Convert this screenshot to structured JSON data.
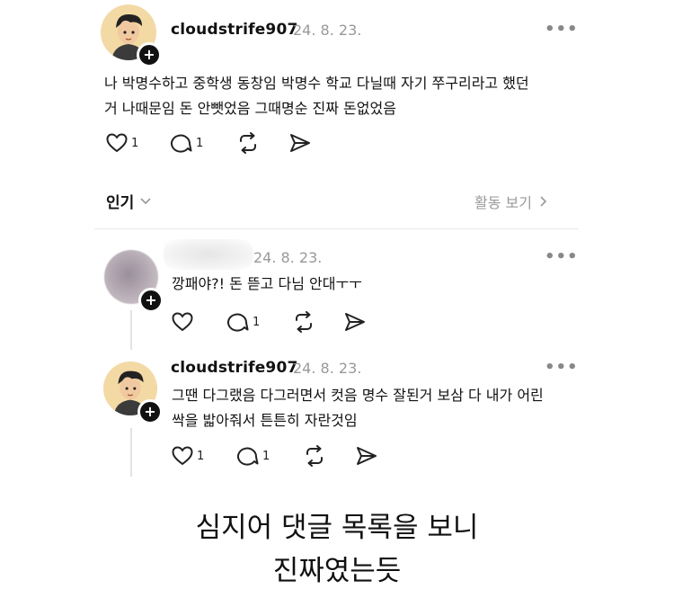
{
  "post": {
    "username": "cloudstrife907",
    "date": "24. 8. 23.",
    "more": "•••",
    "text_line1": "나 박명수하고 중학생 동창임 박명수 학교 다닐때 자기 쭈구리라고 했던",
    "text_line2": "거 나때문임 돈 안뺏었음 그때명순 진짜 돈없었음",
    "like_count": "1",
    "comment_count": "1"
  },
  "sort_bar": {
    "sort_label": "인기",
    "activity_label": "활동 보기"
  },
  "reply1": {
    "date": "24. 8. 23.",
    "more": "•••",
    "text": "깡패야?! 돈 뜯고 다님 안대ㅜㅜ",
    "comment_count": "1"
  },
  "reply2": {
    "username": "cloudstrife907",
    "date": "24. 8. 23.",
    "more": "•••",
    "text_line1": "그땐 다그랬음 다그러면서 컷음 명수 잘된거 보삼 다 내가 어린",
    "text_line2": "싹을 밟아줘서 튼튼히 자란것임",
    "like_count": "1",
    "comment_count": "1"
  },
  "caption": {
    "line1": "심지어 댓글 목록을 보니",
    "line2": "진짜였는듯"
  },
  "colors": {
    "text": "#111111",
    "muted": "#999999",
    "divider": "#e6e6e6",
    "avatar_bg": "#f3d9a4"
  }
}
